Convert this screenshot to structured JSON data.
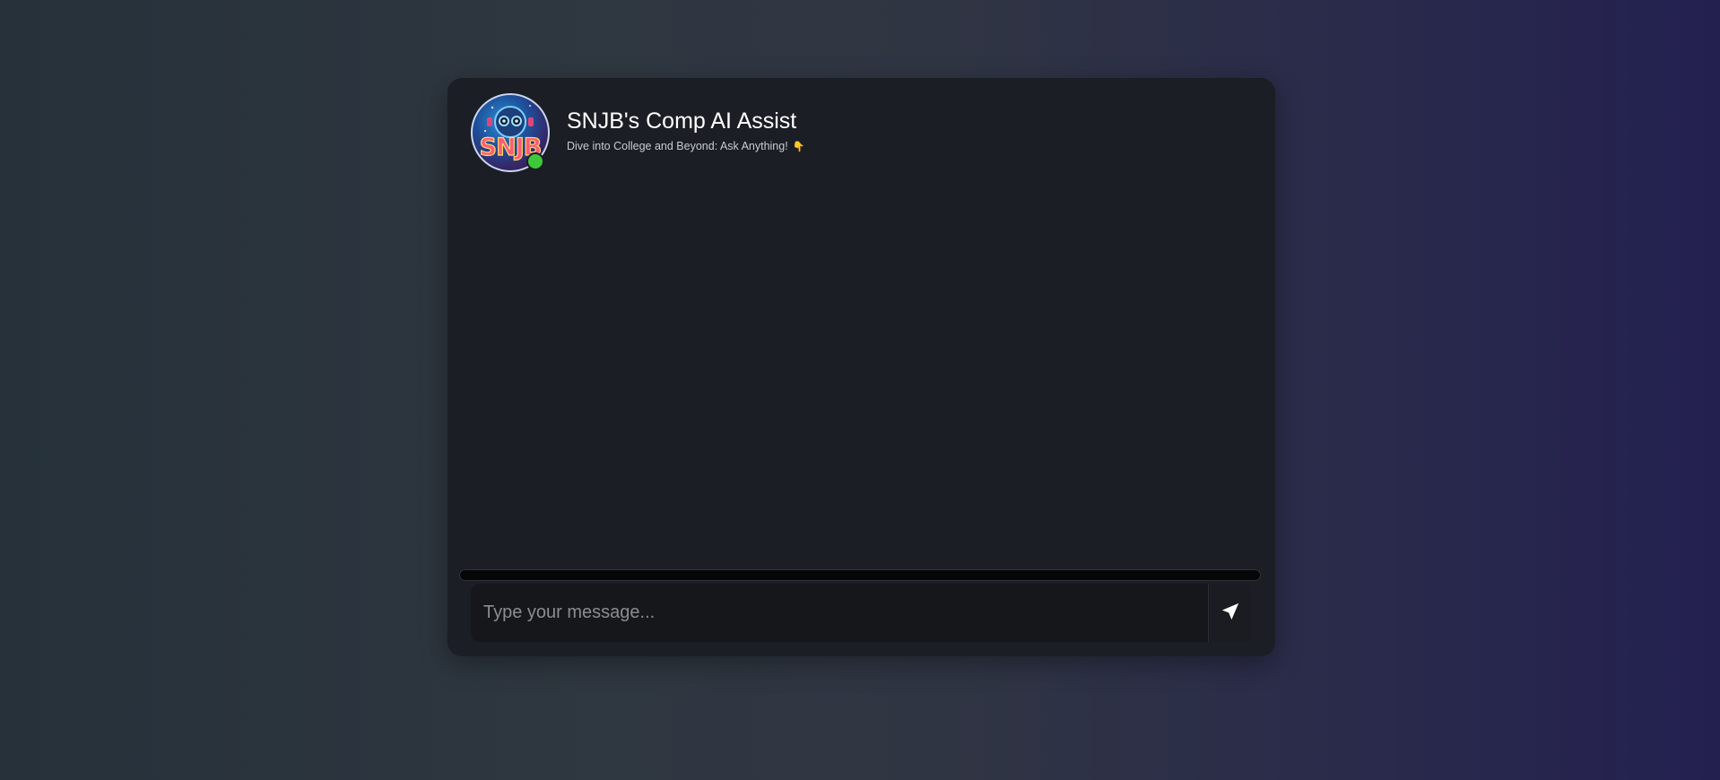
{
  "header": {
    "title": "SNJB's Comp AI Assist",
    "subtitle": "Dive into College and Beyond: Ask Anything!",
    "subtitle_emoji": "👇",
    "avatar_logo_text": "SNJB",
    "status": "online"
  },
  "composer": {
    "placeholder": "Type your message...",
    "value": "",
    "send_icon": "paper-plane-icon"
  },
  "colors": {
    "card_background": "#1b1e24",
    "online_indicator": "#3ec93a",
    "input_background": "#15171b",
    "title_text": "#ffffff"
  }
}
